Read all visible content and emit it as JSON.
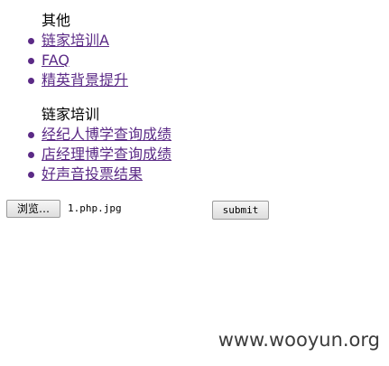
{
  "sections": [
    {
      "title": "其他",
      "links": [
        "链家培训A",
        "FAQ",
        "精英背景提升"
      ]
    },
    {
      "title": "链家培训",
      "links": [
        "经纪人博学查询成绩",
        "店经理博学查询成绩",
        "好声音投票结果"
      ]
    }
  ],
  "upload": {
    "browse_label": "浏览…",
    "file_name": "1.php.jpg",
    "submit_label": "submit"
  },
  "watermark": "www.wooyun.org",
  "colors": {
    "link": "#5b2a86",
    "watermark": "#3c3c3c"
  }
}
